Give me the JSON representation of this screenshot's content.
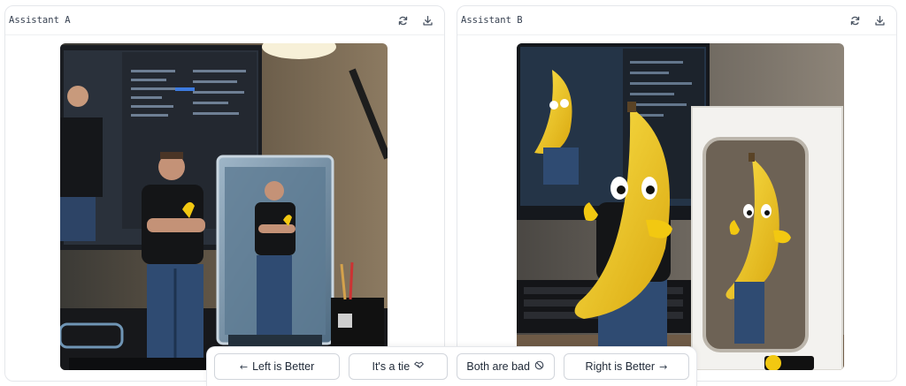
{
  "left_panel": {
    "title": "Assistant A",
    "icons": [
      "refresh-icon",
      "download-icon"
    ],
    "image_alt": "Generated image: man in black t-shirt standing beside a boxed action figure of himself in front of a monitor"
  },
  "right_panel": {
    "title": "Assistant B",
    "icons": [
      "refresh-icon",
      "download-icon"
    ],
    "image_alt": "Generated image: banana-headed character with cartoon eyes beside a boxed banana figure"
  },
  "vote_bar": {
    "left_better": {
      "label": "Left is Better",
      "glyph": "←"
    },
    "tie": {
      "label": "It's a tie",
      "glyph": "🤝"
    },
    "both_bad": {
      "label": "Both are bad",
      "glyph": "⃠"
    },
    "right_better": {
      "label": "Right is Better",
      "glyph": "→"
    }
  },
  "colors": {
    "border": "#e5e7eb",
    "button_border": "#d1d5db",
    "text": "#1f2937",
    "banana": "#f2c811"
  }
}
